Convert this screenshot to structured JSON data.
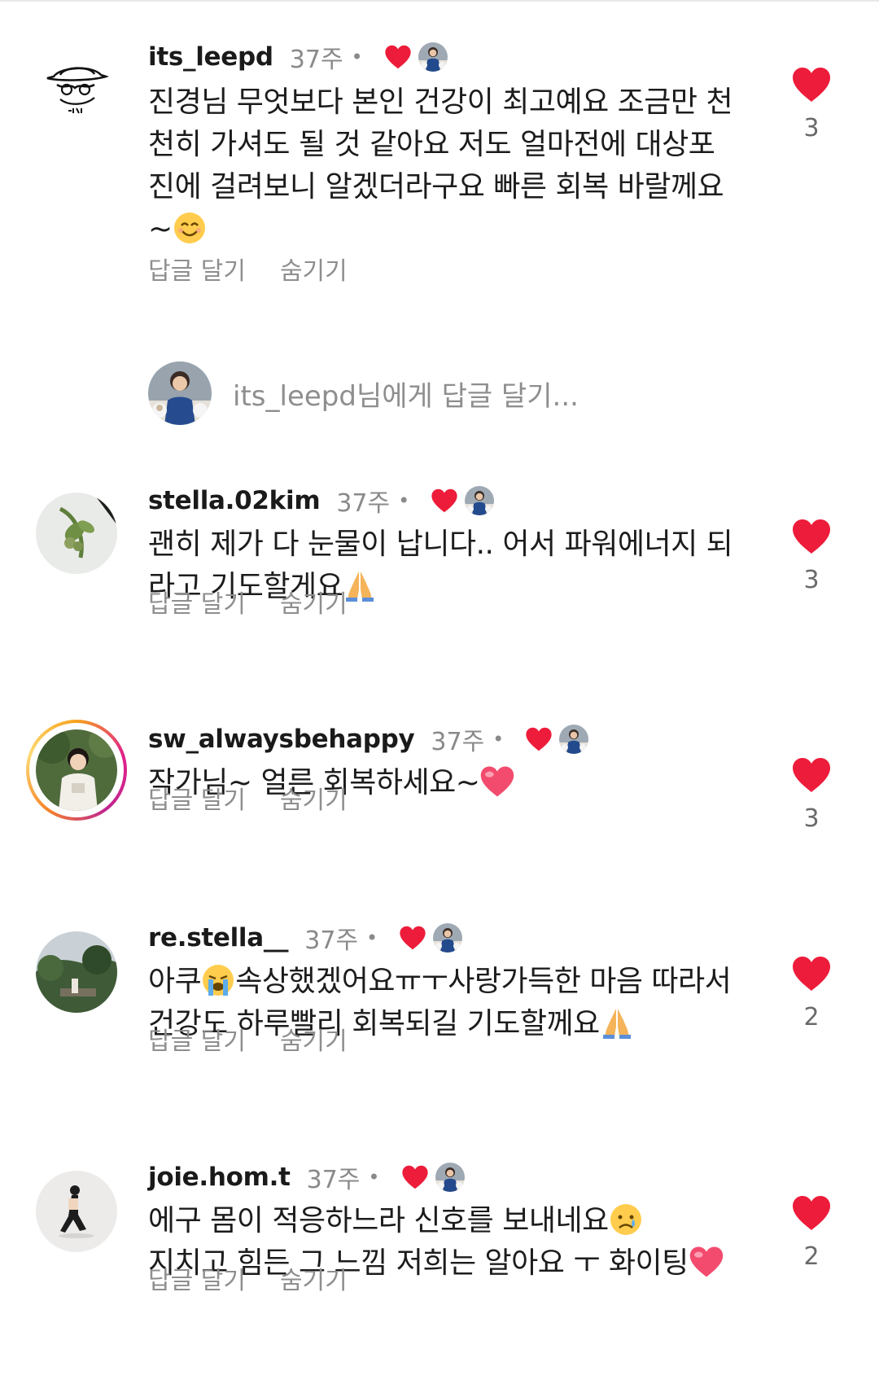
{
  "comments": [
    {
      "username": "its_leepd",
      "time": "37주",
      "dot": "•",
      "text": "진경님 무엇보다 본인 건강이 최고예요 조금만 천천히 가셔도 될 것 같아요 저도 얼마전에 대상포진에 걸려보니 알겠더라구요 빠른 회복 바랄께요~",
      "emoji": "smiling-face-emoji",
      "reply_label": "답글 달기",
      "hide_label": "숨기기",
      "likes": "3",
      "avatar": "signature-hat-avatar"
    },
    {
      "username": "stella.02kim",
      "time": "37주",
      "dot": "•",
      "text": "괜히 제가 다 눈물이 납니다.. 어서 파워에너지 되라고 기도할게요",
      "emoji": "praying-hands-emoji",
      "reply_label": "답글 달기",
      "hide_label": "숨기기",
      "likes": "3",
      "avatar": "plant-photo-avatar"
    },
    {
      "username": "sw_alwaysbehappy",
      "time": "37주",
      "dot": "•",
      "text": "작가님~ 얼른 회복하세요~",
      "emoji": "pink-heart-emoji",
      "reply_label": "답글 달기",
      "hide_label": "숨기기",
      "likes": "3",
      "avatar": "woman-garden-avatar"
    },
    {
      "username": "re.stella__",
      "time": "37주",
      "dot": "•",
      "text_part1": "아쿠",
      "text_part2": "속상했겠어요ㅠㅜ사랑가득한 마음 따라서 건강도 하루빨리 회복되길 기도할께요",
      "emoji_inline": "crying-face-emoji",
      "emoji": "praying-hands-emoji",
      "reply_label": "답글 달기",
      "hide_label": "숨기기",
      "likes": "2",
      "avatar": "trees-landscape-avatar"
    },
    {
      "username": "joie.hom.t",
      "time": "37주",
      "dot": "•",
      "text_part1": "에구 몸이 적응하느라 신호를 보내네요",
      "text_part2": "지치고 힘든 그 느낌 저희는 알아요 ㅜ 화이팅",
      "emoji_inline": "sad-tear-face-emoji",
      "emoji": "pink-heart-emoji",
      "reply_label": "답글 달기",
      "hide_label": "숨기기",
      "likes": "2",
      "avatar": "yoga-woman-avatar"
    }
  ],
  "reply_box": {
    "username": "its_leepd",
    "suffix": "님에게 답글 달기..."
  },
  "colors": {
    "heart_red": "#ed1c3a",
    "muted_text": "#8e8e8e",
    "username": "#1a1a1a"
  }
}
